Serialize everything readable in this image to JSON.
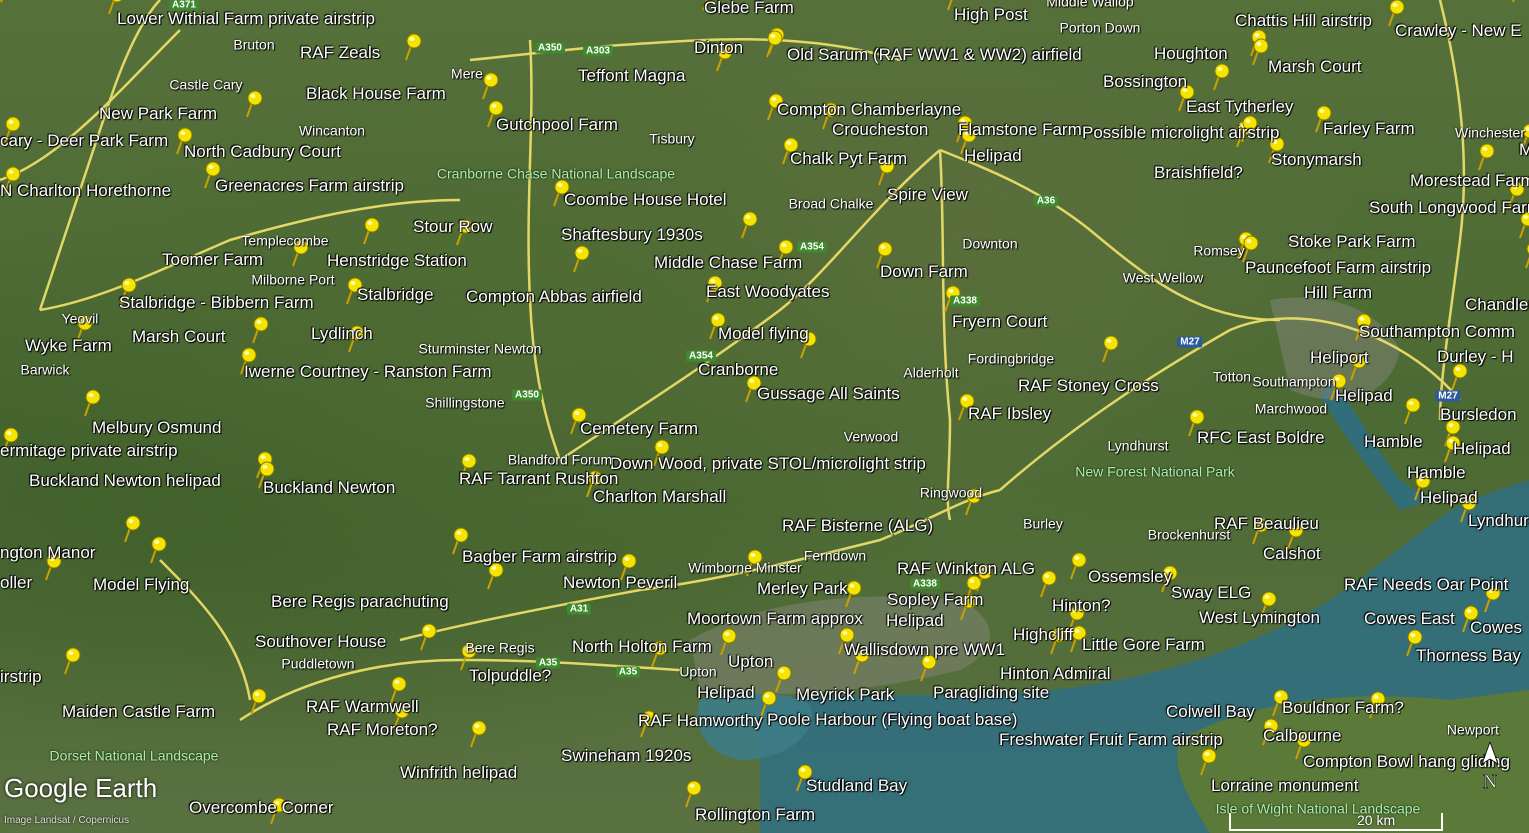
{
  "map": {
    "brand": "Google Earth",
    "credit": "Image Landsat / Copernicus",
    "scale": "20 km",
    "compass": "N",
    "north_arrow_icon": "compass-arrow-icon"
  },
  "colors": {
    "pin": "#f5e400",
    "road": "#f3e36b",
    "sea": "#2f6f82",
    "park_text": "#a8f0a8",
    "road_shield_green": "#3f8a2e",
    "road_shield_blue": "#2c5aa0"
  },
  "placemarks": [
    "Lower Withial Farm private airstrip",
    "RAF Zeals",
    "Black House Farm",
    "Gutchpool Farm",
    "New Park Farm",
    "cary - Deer Park Farm",
    "North Cadbury Court",
    "N Charlton Horethorne",
    "Greenacres Farm airstrip",
    "Henstridge Station",
    "Toomer Farm",
    "Stour Row",
    "Stalbridge - Bibbern Farm",
    "Stalbridge",
    "Lydlinch",
    "Marsh Court",
    "Wyke Farm",
    "Iwerne Courtney - Ranston Farm",
    "Melbury Osmund",
    "ermitage private airstrip",
    "Buckland Newton helipad",
    "Buckland Newton",
    "Glebe Farm",
    "Dinton",
    "Teffont Magna",
    "Old Sarum (RAF WW1 & WW2) airfield",
    "High Post",
    "Compton Chamberlayne",
    "Croucheston",
    "Flamstone Farm",
    "Helipad",
    "Chalk Pyt Farm",
    "Spire View",
    "Coombe House Hotel",
    "Shaftesbury 1930s",
    "Middle Chase Farm",
    "Compton Abbas airfield",
    "East Woodyates",
    "Down Farm",
    "Fryern Court",
    "Model flying",
    "Cranborne",
    "Gussage All Saints",
    "RAF Ibsley",
    "RAF Stoney Cross",
    "Cemetery Farm",
    "Down Wood, private STOL/microlight strip",
    "RAF Tarrant Rushton",
    "Charlton Marshall",
    "RAF Bisterne (ALG)",
    "Bagber Farm airstrip",
    "Newton Peveril",
    "Merley Park",
    "RAF Winkton ALG",
    "Sopley Farm",
    "Moortown Farm approx",
    "Helipad",
    "Bere Regis parachuting",
    "Southover House",
    "North Holton Farm",
    "Upton",
    "Wallisdown pre WW1",
    "Tolpuddle?",
    "Helipad",
    "Meyrick Park",
    "Paragliding site",
    "RAF Warmwell",
    "RAF Moreton?",
    "RAF Hamworthy",
    "Poole Harbour (Flying boat base)",
    "Swineham 1920s",
    "Winfrith helipad",
    "Studland Bay",
    "Rollington Farm",
    "Maiden Castle Farm",
    "Overcombe Corner",
    "Model Flying",
    "irstrip",
    "ngton Manor",
    "oller",
    "Chattis Hill airstrip",
    "Crawley - New E",
    "Houghton",
    "Marsh Court",
    "Bossington",
    "East Tytherley",
    "Possible microlight airstrip",
    "Farley Farm",
    "Braishfield?",
    "Stonymarsh",
    "Morestead Farm",
    "More",
    "South Longwood Farm",
    "Stoke Park Farm",
    "Pauncefoot Farm airstrip",
    "Chandler's Ford",
    "Hill Farm",
    "Southampton Comm",
    "Durley - H",
    "Heliport",
    "Helipad",
    "Bursledon",
    "Hamble",
    "Helipad",
    "Hamble",
    "Helipad",
    "Lyndhurst",
    "RFC East Boldre",
    "RAF Beaulieu",
    "Calshot",
    "Ossemsley",
    "Sway ELG",
    "Hinton?",
    "West Lymington",
    "RAF Needs Oar Point",
    "Cowes East",
    "Cowes",
    "Highcliff",
    "Little Gore Farm",
    "Hinton Admiral",
    "Thorness Bay",
    "Colwell Bay",
    "Bouldnor Farm?",
    "Freshwater Fruit Farm airstrip",
    "Calbourne",
    "Compton Bowl hang gliding",
    "Lorraine monument"
  ],
  "places": [
    "Bruton",
    "Castle Cary",
    "Wincanton",
    "Mere",
    "Tisbury",
    "Templecombe",
    "Milborne Port",
    "Yeovil",
    "Barwick",
    "Sturminster Newton",
    "Shillingstone",
    "Blandford Forum",
    "Broad Chalke",
    "Downton",
    "West Wellow",
    "Romsey",
    "Fordingbridge",
    "Alderholt",
    "Verwood",
    "Ringwood",
    "Burley",
    "Lyndhurst",
    "Totton",
    "Southampton",
    "Marchwood",
    "Brockenhurst",
    "Wimborne Minster",
    "Ferndown",
    "Bere Regis",
    "Puddletown",
    "Upton",
    "Porton Down",
    "Winchester",
    "Newport",
    "Middle Wallop"
  ],
  "parks": [
    "Cranborne Chase National Landscape",
    "New Forest National Park",
    "Dorset National Landscape",
    "Isle of Wight National Landscape"
  ],
  "roads": [
    "A371",
    "A350",
    "A303",
    "A354",
    "A36",
    "A338",
    "A350",
    "A354",
    "A31",
    "A35",
    "A35",
    "A338",
    "M27",
    "M27"
  ]
}
